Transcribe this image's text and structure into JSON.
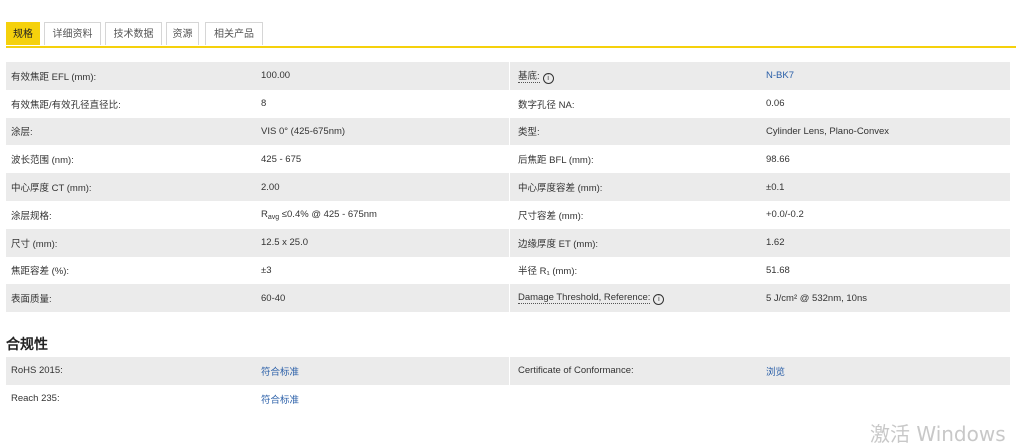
{
  "tabs": [
    "规格",
    "详细资料",
    "技术数据",
    "资源",
    "相关产品"
  ],
  "specs": [
    {
      "l1": "有效焦距 EFL (mm):",
      "v1": "100.00",
      "l2": "基底:",
      "v2": "N-BK7",
      "v2_link": true,
      "l2_info": true
    },
    {
      "l1": "有效焦距/有效孔径直径比:",
      "v1": "8",
      "l2": "数字孔径 NA:",
      "v2": "0.06"
    },
    {
      "l1": "涂层:",
      "v1": "VIS 0° (425-675nm)",
      "l2": "类型:",
      "v2": "Cylinder Lens, Plano-Convex"
    },
    {
      "l1": "波长范围 (nm):",
      "v1": "425 - 675",
      "l2": "后焦距 BFL (mm):",
      "v2": "98.66"
    },
    {
      "l1": "中心厚度 CT (mm):",
      "v1": "2.00",
      "l2": "中心厚度容差 (mm):",
      "v2": "±0.1"
    },
    {
      "l1": "涂层规格:",
      "v1_prefix": "R",
      "v1_sub": "avg",
      "v1": " ≤0.4% @ 425 - 675nm",
      "l2": "尺寸容差 (mm):",
      "v2": "+0.0/-0.2"
    },
    {
      "l1": "尺寸 (mm):",
      "v1": "12.5 x 25.0",
      "l2": "边缘厚度 ET (mm):",
      "v2": "1.62"
    },
    {
      "l1": "焦距容差 (%):",
      "v1": "±3",
      "l2": "半径 R₁ (mm):",
      "v2": "51.68"
    },
    {
      "l1": "表面质量:",
      "v1": "60-40",
      "l2": "Damage Threshold, Reference:",
      "l2_info": true,
      "v2": "5 J/cm² @ 532nm, 10ns"
    }
  ],
  "compliance_title": "合规性",
  "compliance": [
    {
      "l1": "RoHS 2015:",
      "v1": "符合标准",
      "l2": "Certificate of Conformance:",
      "v2": "浏览"
    },
    {
      "l1": "Reach 235:",
      "v1": "符合标准",
      "l2": "",
      "v2": ""
    }
  ],
  "info_glyph": "i",
  "watermark": "激活 Windows"
}
